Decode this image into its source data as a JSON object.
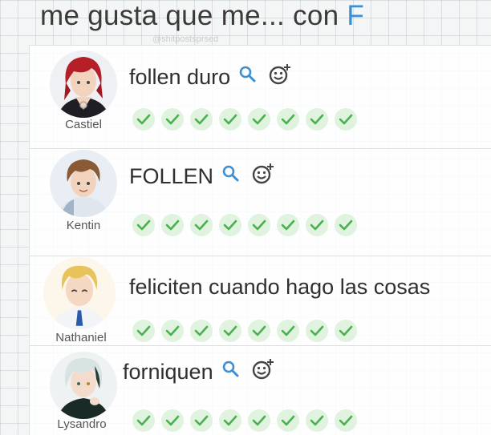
{
  "title": {
    "text": "me gusta que me... con ",
    "highlight": "F"
  },
  "watermark": "@shitpostsprsed",
  "icons": {
    "search": "search-icon",
    "emoji": "emoji-add-icon",
    "check": "check-icon"
  },
  "colors": {
    "check_bg": "#dff3de",
    "check_mark": "#4caf50",
    "search": "#3d8fd4",
    "title_highlight": "#3d8fd4"
  },
  "rows": [
    {
      "name": "Castiel",
      "answer": "follen duro",
      "checks": 8,
      "has_icons": true
    },
    {
      "name": "Kentin",
      "answer": "FOLLEN",
      "checks": 8,
      "has_icons": true
    },
    {
      "name": "Nathaniel",
      "answer": "feliciten cuando hago las cosas",
      "checks": 8,
      "has_icons": false
    },
    {
      "name": "Lysandro",
      "answer": "forniquen",
      "checks": 8,
      "has_icons": true
    }
  ]
}
